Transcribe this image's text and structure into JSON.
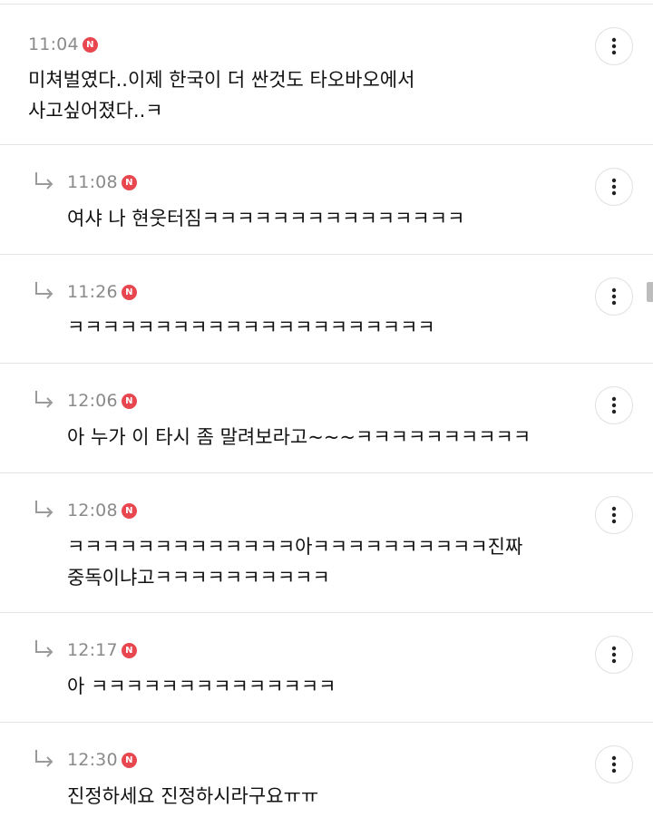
{
  "comments": [
    {
      "time": "11:04",
      "badge": "N",
      "is_reply": false,
      "text": "미쳐벌였다..이제 한국이 더 싼것도 타오바오에서\n사고싶어졌다..ㅋ"
    },
    {
      "time": "11:08",
      "badge": "N",
      "is_reply": true,
      "text": "여샤 나 현웃터짐ㅋㅋㅋㅋㅋㅋㅋㅋㅋㅋㅋㅋㅋㅋㅋ"
    },
    {
      "time": "11:26",
      "badge": "N",
      "is_reply": true,
      "text": "ㅋㅋㅋㅋㅋㅋㅋㅋㅋㅋㅋㅋㅋㅋㅋㅋㅋㅋㅋㅋㅋ"
    },
    {
      "time": "12:06",
      "badge": "N",
      "is_reply": true,
      "text": "아 누가 이 타시 좀 말려보라고~~~ㅋㅋㅋㅋㅋㅋㅋㅋㅋㅋ"
    },
    {
      "time": "12:08",
      "badge": "N",
      "is_reply": true,
      "text": "ㅋㅋㅋㅋㅋㅋㅋㅋㅋㅋㅋㅋㅋ아ㅋㅋㅋㅋㅋㅋㅋㅋㅋㅋ진짜\n중독이냐고ㅋㅋㅋㅋㅋㅋㅋㅋㅋㅋ"
    },
    {
      "time": "12:17",
      "badge": "N",
      "is_reply": true,
      "text": "아 ㅋㅋㅋㅋㅋㅋㅋㅋㅋㅋㅋㅋㅋㅋ"
    },
    {
      "time": "12:30",
      "badge": "N",
      "is_reply": true,
      "text": "진정하세요 진정하시라구요ㅠㅠ"
    }
  ],
  "icons": {
    "reply": "reply-arrow-icon",
    "more": "more-vertical-icon",
    "new": "new-badge"
  },
  "colors": {
    "badge": "#e8474f",
    "time": "#8a8a8a",
    "divider": "#e4e4e4",
    "text": "#111111"
  }
}
